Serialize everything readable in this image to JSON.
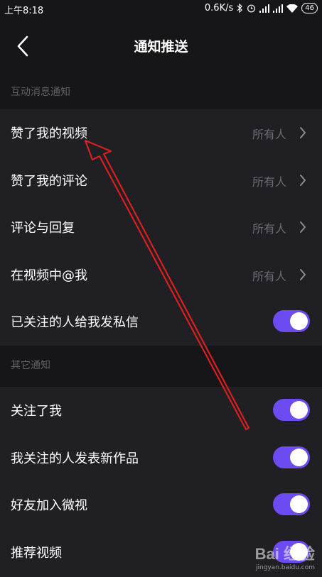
{
  "status_bar": {
    "time": "上午8:18",
    "net_speed": "0.6K/s",
    "battery": "46",
    "icons": [
      "bluetooth-icon",
      "alarm-icon",
      "signal-icon",
      "signal-icon",
      "wifi-icon",
      "battery-icon"
    ]
  },
  "header": {
    "title": "通知推送",
    "back_icon": "chevron-left-icon"
  },
  "section_interaction": {
    "title": "互动消息通知",
    "rows": [
      {
        "label": "赞了我的视频",
        "value": "所有人"
      },
      {
        "label": "赞了我的评论",
        "value": "所有人"
      },
      {
        "label": "评论与回复",
        "value": "所有人"
      },
      {
        "label": "在视频中@我",
        "value": "所有人"
      },
      {
        "label": "已关注的人给我发私信",
        "toggle": true
      }
    ]
  },
  "section_other": {
    "title": "其它通知",
    "rows": [
      {
        "label": "关注了我",
        "toggle": true
      },
      {
        "label": "我关注的人发表新作品",
        "toggle": true
      },
      {
        "label": "好友加入微视",
        "toggle": true
      },
      {
        "label": "推荐视频",
        "toggle": true
      }
    ]
  },
  "watermark": {
    "logo": "Bai 经验",
    "url": "jingyan.baidu.com"
  },
  "colors": {
    "accent": "#6d4bf2",
    "annotation": "#d62020",
    "background": "#161618",
    "row_background": "#202024"
  }
}
